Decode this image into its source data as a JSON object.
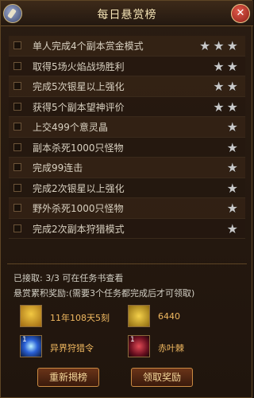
{
  "title": "每日悬赏榜",
  "colors": {
    "accent": "#f0b860",
    "star": "#c8c8c8",
    "panel": "#20150d"
  },
  "tasks": [
    {
      "label": "单人完成4个副本赏金模式",
      "stars": 3
    },
    {
      "label": "取得5场火焰战场胜利",
      "stars": 2
    },
    {
      "label": "完成5次银星以上强化",
      "stars": 2
    },
    {
      "label": "获得5个副本望神评价",
      "stars": 2
    },
    {
      "label": "上交499个意灵晶",
      "stars": 1
    },
    {
      "label": "副本杀死1000只怪物",
      "stars": 1
    },
    {
      "label": "完成99连击",
      "stars": 1
    },
    {
      "label": "完成2次银星以上强化",
      "stars": 1
    },
    {
      "label": "野外杀死1000只怪物",
      "stars": 1
    },
    {
      "label": "完成2次副本狩猎模式",
      "stars": 1
    }
  ],
  "accepted_text": "已接取: 3/3  可在任务书查看",
  "rewards_title": "悬赏累积奖励:(需要3个任务都完成后才可领取)",
  "rewards": [
    {
      "label": "11年108天5刻",
      "icon": "scroll-icon"
    },
    {
      "label": "6440",
      "icon": "gold-coin-icon"
    },
    {
      "label": "异界狩猎令",
      "count": "1",
      "icon": "blue-orb-icon"
    },
    {
      "label": "赤叶棘",
      "count": "1",
      "icon": "red-leaf-icon"
    }
  ],
  "buttons": {
    "refresh": "重新揭榜",
    "claim": "领取奖励"
  },
  "icons": {
    "left": "sword-emblem-icon",
    "close": "close-icon"
  }
}
